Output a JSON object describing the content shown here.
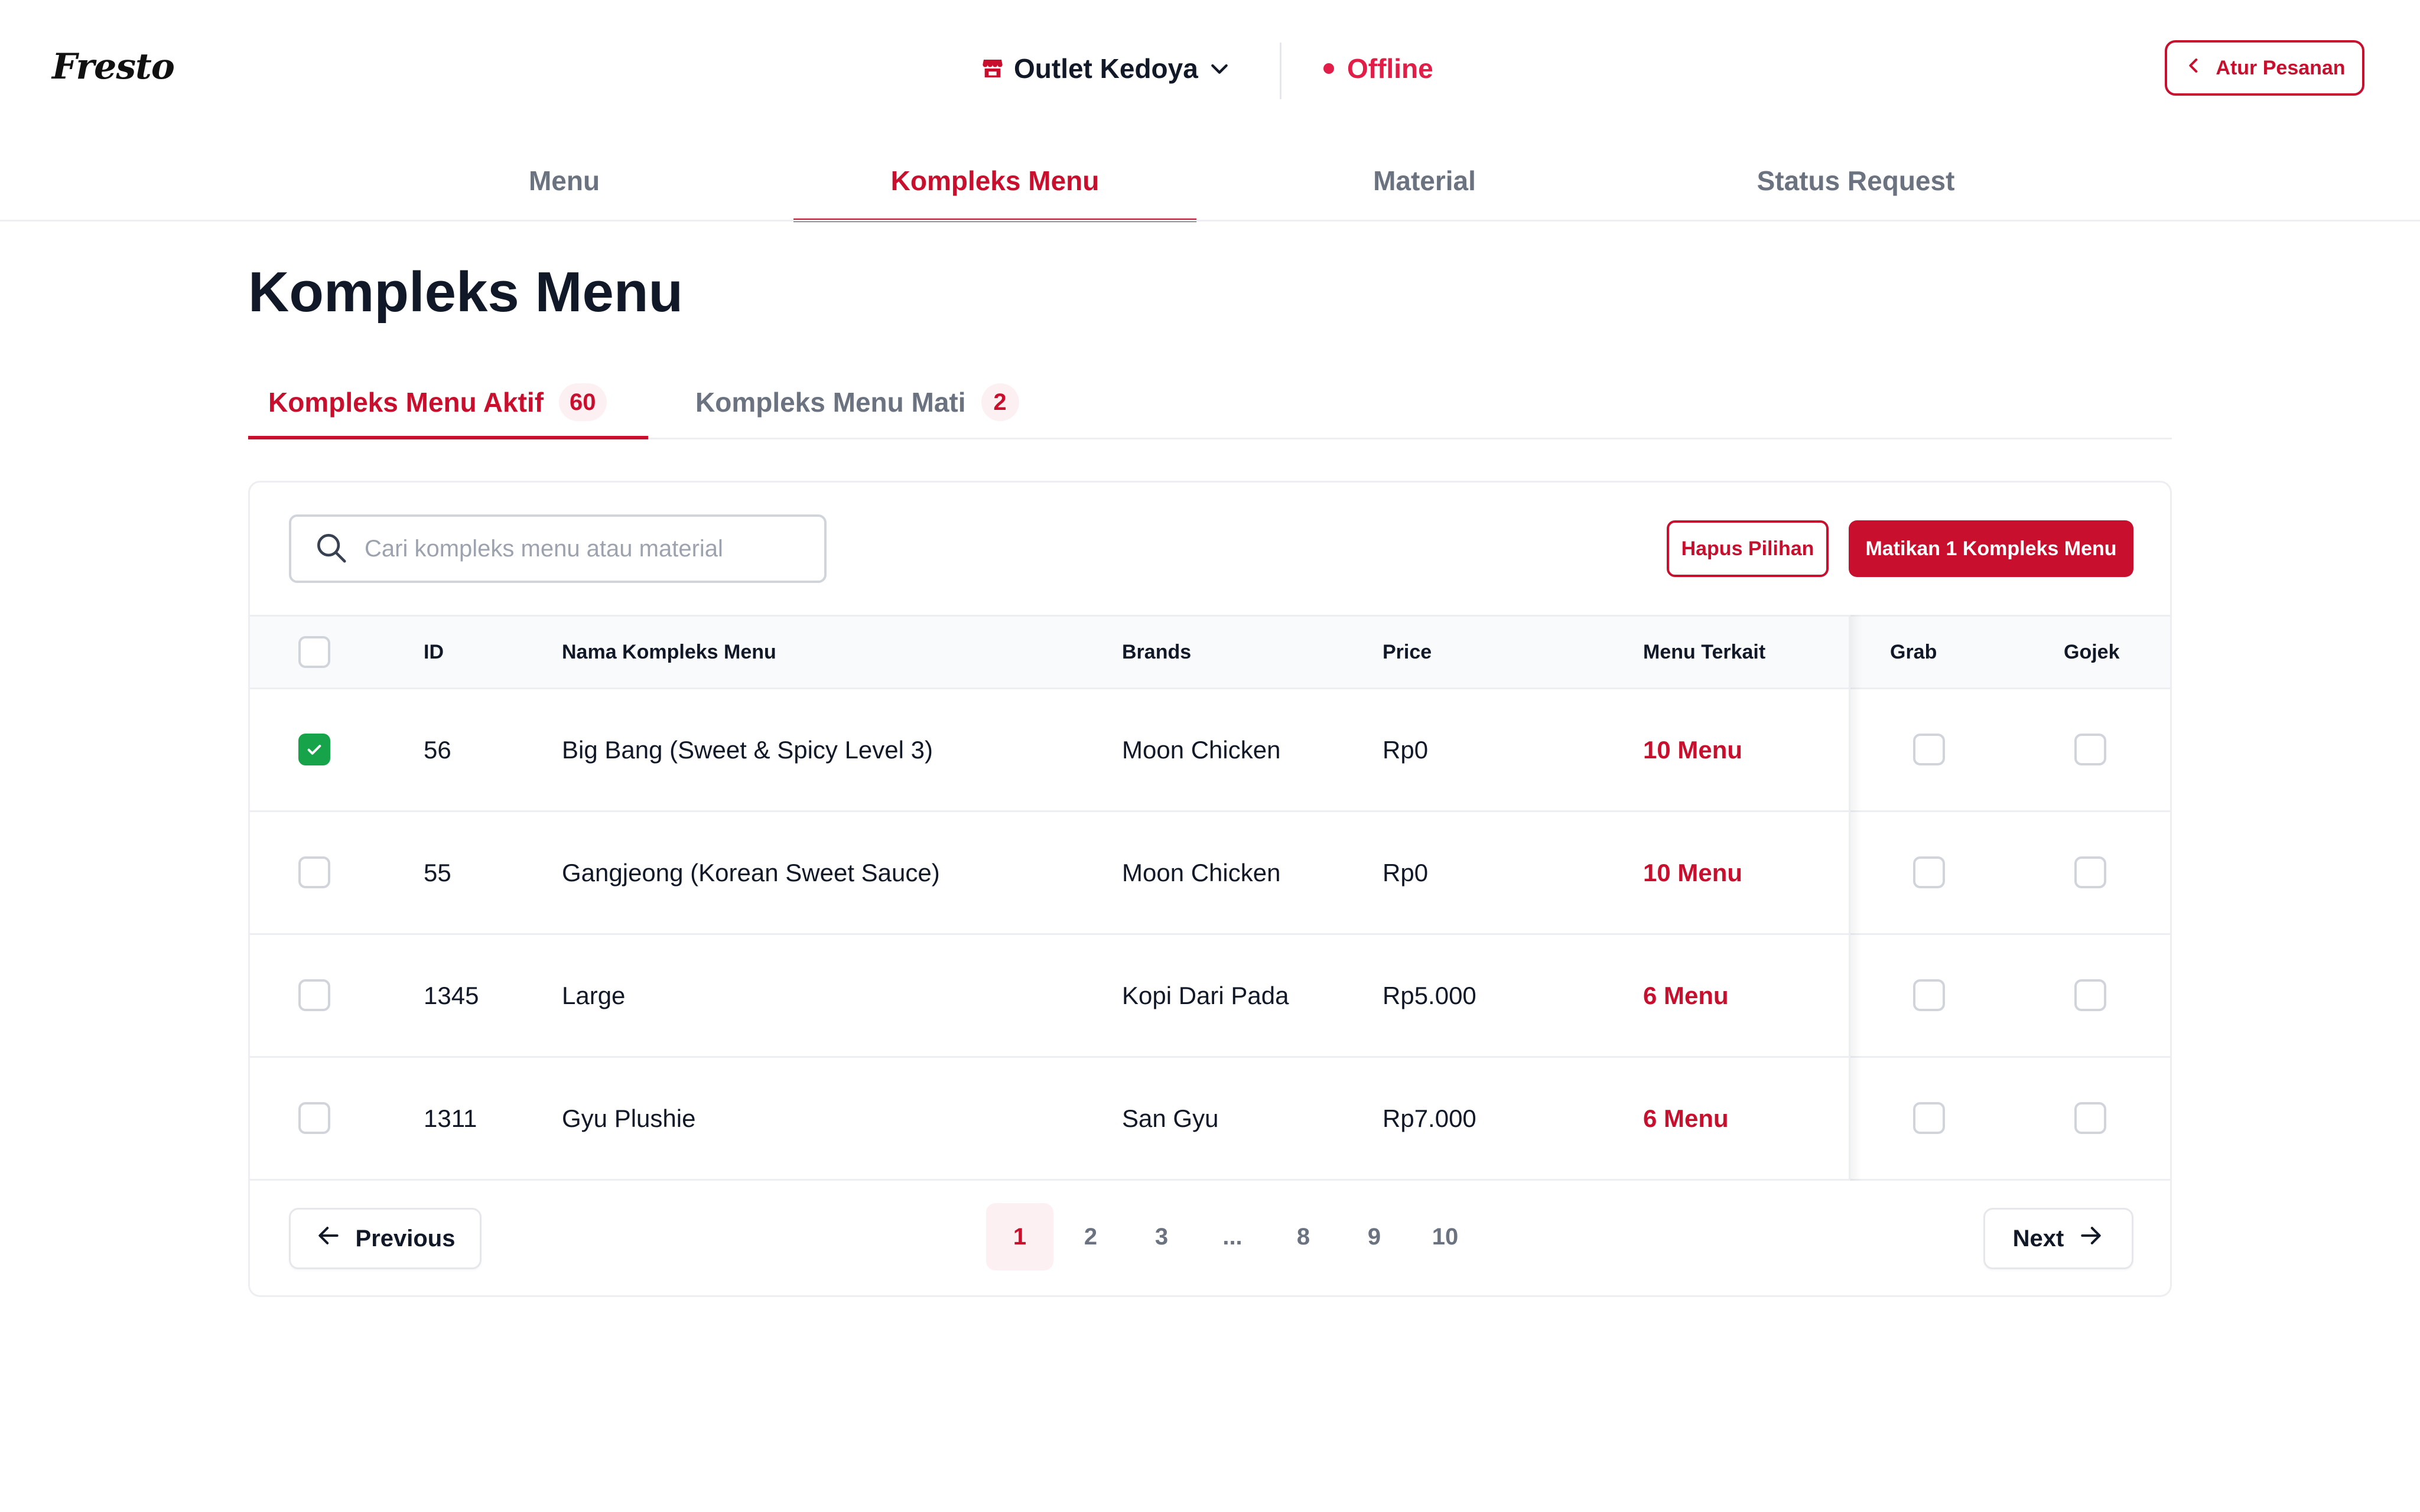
{
  "header": {
    "logo": "Fresto",
    "outlet_name": "Outlet Kedoya",
    "status_label": "Offline",
    "status_color": "#e11d48",
    "back_button_label": "Atur Pesanan",
    "icons": [
      "store-icon",
      "chevron-down-icon",
      "chevron-left-icon"
    ]
  },
  "nav": {
    "tabs": [
      {
        "label": "Menu",
        "active": false
      },
      {
        "label": "Kompleks Menu",
        "active": true
      },
      {
        "label": "Material",
        "active": false
      },
      {
        "label": "Status Request",
        "active": false
      }
    ]
  },
  "page": {
    "title": "Kompleks Menu"
  },
  "sub_tabs": [
    {
      "label": "Kompleks Menu Aktif",
      "count": "60",
      "active": true
    },
    {
      "label": "Kompleks Menu Mati",
      "count": "2",
      "active": false
    }
  ],
  "toolbar": {
    "search_placeholder": "Cari kompleks menu atau material",
    "search_value": "",
    "clear_selection_label": "Hapus Pilihan",
    "deactivate_label": "Matikan 1 Kompleks Menu"
  },
  "table": {
    "columns": [
      "ID",
      "Nama Kompleks Menu",
      "Brands",
      "Price",
      "Menu Terkait",
      "Grab",
      "Gojek"
    ],
    "rows": [
      {
        "selected": true,
        "id": "56",
        "name": "Big Bang (Sweet & Spicy Level 3)",
        "brand": "Moon Chicken",
        "price": "Rp0",
        "menu_terkait": "10 Menu",
        "grab": false,
        "gojek": false
      },
      {
        "selected": false,
        "id": "55",
        "name": "Gangjeong (Korean Sweet Sauce)",
        "brand": "Moon Chicken",
        "price": "Rp0",
        "menu_terkait": "10 Menu",
        "grab": false,
        "gojek": false
      },
      {
        "selected": false,
        "id": "1345",
        "name": "Large",
        "brand": "Kopi Dari Pada",
        "price": "Rp5.000",
        "menu_terkait": "6 Menu",
        "grab": false,
        "gojek": false
      },
      {
        "selected": false,
        "id": "1311",
        "name": "Gyu Plushie",
        "brand": "San Gyu",
        "price": "Rp7.000",
        "menu_terkait": "6 Menu",
        "grab": false,
        "gojek": false
      }
    ]
  },
  "pagination": {
    "previous_label": "Previous",
    "next_label": "Next",
    "pages": [
      "1",
      "2",
      "3",
      "...",
      "8",
      "9",
      "10"
    ],
    "current_page": "1"
  },
  "colors": {
    "accent": "#c8102e",
    "accent_soft": "#fdf0f2",
    "checkbox_checked": "#17a34a",
    "muted_text": "#6b7280"
  }
}
